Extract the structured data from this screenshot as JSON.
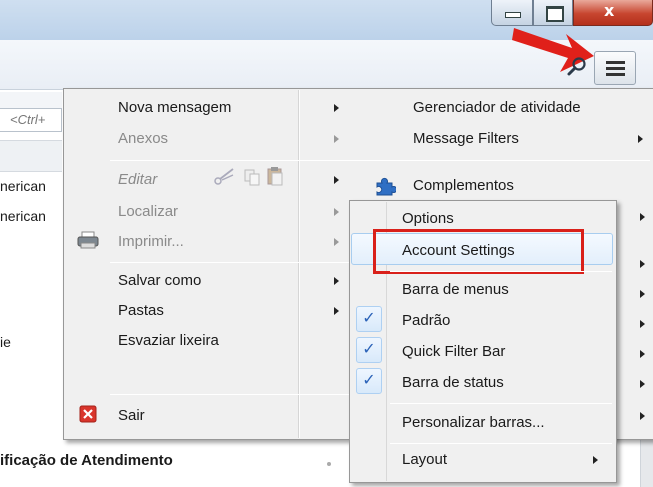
{
  "left_pane": {
    "search_placeholder": "<Ctrl+",
    "row1": "nerican",
    "row2": "nerican",
    "row3": "ie",
    "bottom": "ificação de Atendimento"
  },
  "app_menu": {
    "column1": [
      {
        "label": "Nova mensagem",
        "enabled": true,
        "submenu": true
      },
      {
        "label": "Anexos",
        "enabled": false,
        "submenu": true
      },
      {
        "label": "Editar",
        "enabled": false,
        "submenu": true
      },
      {
        "label": "Localizar",
        "enabled": false,
        "submenu": true
      },
      {
        "label": "Imprimir...",
        "enabled": false,
        "submenu": true
      },
      {
        "label": "Salvar como",
        "enabled": true,
        "submenu": true
      },
      {
        "label": "Pastas",
        "enabled": true,
        "submenu": true
      },
      {
        "label": "Esvaziar lixeira",
        "enabled": true,
        "submenu": false
      },
      {
        "label": "Sair",
        "enabled": true,
        "submenu": false
      }
    ],
    "column2": [
      {
        "label": "Gerenciador de atividade",
        "submenu": false
      },
      {
        "label": "Message Filters",
        "submenu": true
      },
      {
        "label": "Complementos",
        "submenu": false
      }
    ]
  },
  "options_submenu": {
    "items": [
      {
        "label": "Options",
        "checked": false,
        "submenu": false
      },
      {
        "label": "Account Settings",
        "checked": false,
        "submenu": false
      },
      {
        "label": "Barra de menus",
        "checked": false,
        "submenu": false
      },
      {
        "label": "Padrão",
        "checked": true,
        "submenu": false
      },
      {
        "label": "Quick Filter Bar",
        "checked": true,
        "submenu": false
      },
      {
        "label": "Barra de status",
        "checked": true,
        "submenu": false
      },
      {
        "label": "Personalizar barras...",
        "checked": false,
        "submenu": false
      },
      {
        "label": "Layout",
        "checked": false,
        "submenu": true
      }
    ]
  },
  "colors": {
    "highlight_frame": "#d9201a",
    "annotation_arrow": "#e0201a",
    "check_color": "#2a62b8"
  },
  "icons": [
    "minimize-icon",
    "maximize-icon",
    "close-icon",
    "search-icon",
    "hamburger-menu-icon",
    "edit-scissors-icon",
    "copy-icon",
    "paste-icon",
    "printer-icon",
    "exit-icon",
    "puzzle-piece-icon",
    "checkmark-icon",
    "chevron-right-icon"
  ]
}
